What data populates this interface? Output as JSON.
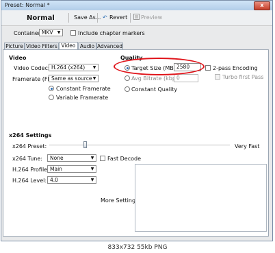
{
  "window": {
    "title": "Preset: Normal *",
    "close_glyph": "x"
  },
  "toolbar": {
    "preset_name": "Normal",
    "save_as": "Save As...",
    "revert": "Revert",
    "preview": "Preview",
    "revert_icon": "undo-arrow-icon",
    "preview_icon": "preview-icon"
  },
  "container": {
    "label": "Container:",
    "value": "MKV",
    "include_chapter_markers": "Include chapter markers"
  },
  "tabs": [
    "Picture",
    "Video Filters",
    "Video",
    "Audio",
    "Advanced"
  ],
  "active_tab": "Video",
  "video": {
    "heading": "Video",
    "codec_label": "Video Codec:",
    "codec_value": "H.264 (x264)",
    "framerate_label": "Framerate (FPS):",
    "framerate_value": "Same as source",
    "constant_framerate": "Constant Framerate",
    "variable_framerate": "Variable Framerate"
  },
  "quality": {
    "heading": "Quality",
    "target_size_label": "Target Size (MB)",
    "target_size_value": "2580",
    "avg_bitrate_label": "Avg Bitrate (kbps)",
    "avg_bitrate_value": "0",
    "constant_quality_label": "Constant Quality",
    "two_pass_label": "2-pass Encoding",
    "turbo_first_pass_label": "Turbo first Pass",
    "highlight_color": "#e0151b"
  },
  "x264": {
    "heading": "x264 Settings",
    "preset_label": "x264 Preset:",
    "preset_level_text": "Very Fast",
    "tune_label": "x264 Tune:",
    "tune_value": "None",
    "fast_decode_label": "Fast Decode",
    "profile_label": "H.264 Profile:",
    "profile_value": "Main",
    "level_label": "H.264 Level:",
    "level_value": "4.0",
    "more_settings_label": "More Settings:"
  },
  "caption": "833x732 55kb PNG"
}
